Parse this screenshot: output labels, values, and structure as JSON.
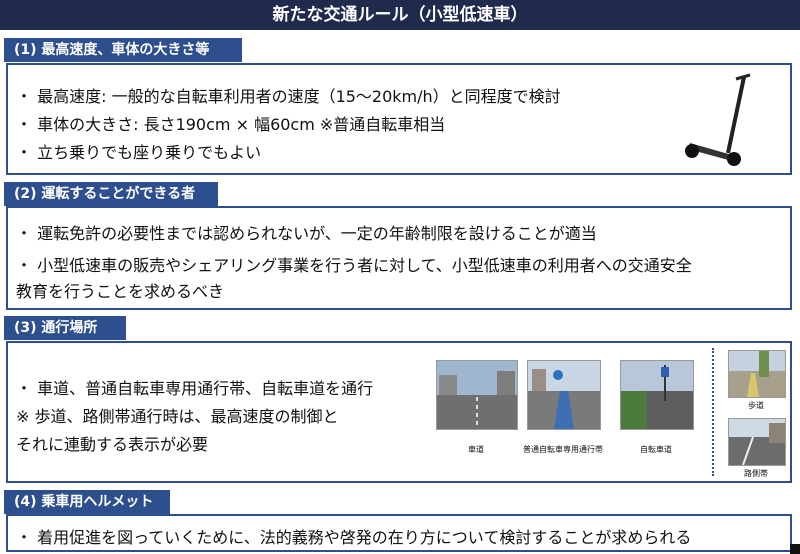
{
  "title": "新たな交通ルール（小型低速車）",
  "sections": [
    {
      "heading": "(1)  最高速度、車体の大きさ等",
      "lines": [
        "・  最高速度: 一般的な自転車利用者の速度（15～20km/h）と同程度で検討",
        "・  車体の大きさ: 長さ190cm × 幅60cm  ※普通自転車相当",
        "・  立ち乗りでも座り乗りでもよい"
      ]
    },
    {
      "heading": "(2)  運転することができる者",
      "lines": [
        "・  運転免許の必要性までは認められないが、一定の年齢制限を設けることが適当",
        "・  小型低速車の販売やシェアリング事業を行う者に対して、小型低速車の利用者への交通安全",
        "    教育を行うことを求めるべき"
      ]
    },
    {
      "heading": "(3)  通行場所",
      "lines": [
        "・  車道、普通自転車専用通行帯、自転車道を通行",
        "※   歩道、路側帯通行時は、最高速度の制御と",
        "     それに連動する表示が必要"
      ],
      "photo_captions": [
        "車道",
        "普通自転車専用通行帯",
        "自転車道",
        "歩道",
        "路側帯"
      ]
    },
    {
      "heading": "(4)  乗車用ヘルメット",
      "lines": [
        "・  着用促進を図っていくために、法的義務や啓発の在り方について検討することが求められる"
      ]
    }
  ]
}
